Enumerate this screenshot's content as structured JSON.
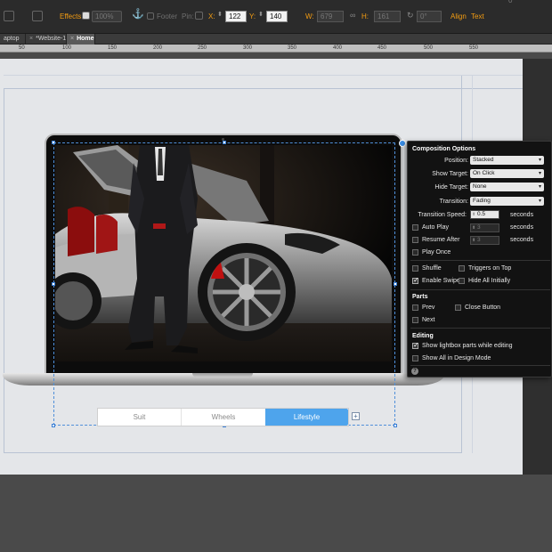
{
  "toolbar": {
    "effects_label": "Effects:",
    "opacity_value": "100%",
    "footer_label": "Footer",
    "pin_label": "Pin:",
    "x_label": "X:",
    "x_value": "122",
    "y_label": "Y:",
    "y_value": "140",
    "w_label": "W:",
    "w_value": "679",
    "h_label": "H:",
    "h_value": "161",
    "rotation_value": "0°",
    "align_label": "Align",
    "text_label": "Text",
    "fill_value": "0"
  },
  "tabs": [
    {
      "label": "aptop"
    },
    {
      "label": "*Website-1"
    },
    {
      "label": "Home"
    }
  ],
  "ruler": [
    "50",
    "100",
    "150",
    "200",
    "250",
    "300",
    "350",
    "400",
    "450",
    "500",
    "550"
  ],
  "widget": {
    "tabs": [
      {
        "label": "Suit"
      },
      {
        "label": "Wheels"
      },
      {
        "label": "Lifestyle"
      }
    ],
    "add_icon": "+"
  },
  "panel": {
    "title": "Composition Options",
    "position_label": "Position:",
    "position_value": "Stacked",
    "show_target_label": "Show Target:",
    "show_target_value": "On Click",
    "hide_target_label": "Hide Target:",
    "hide_target_value": "None",
    "transition_label": "Transition:",
    "transition_value": "Fading",
    "transition_speed_label": "Transition Speed:",
    "transition_speed_value": "0.5",
    "seconds": "seconds",
    "auto_play_label": "Auto Play",
    "auto_play_value": "3",
    "resume_after_label": "Resume After",
    "resume_after_value": "3",
    "play_once_label": "Play Once",
    "shuffle_label": "Shuffle",
    "triggers_on_top_label": "Triggers on Top",
    "enable_swipe_label": "Enable Swipe",
    "hide_all_initially_label": "Hide All Initially",
    "parts_title": "Parts",
    "prev_label": "Prev",
    "close_button_label": "Close Button",
    "next_label": "Next",
    "editing_title": "Editing",
    "show_lightbox_label": "Show lightbox parts while editing",
    "show_all_design_label": "Show All in Design Mode",
    "help_icon": "?",
    "checks": {
      "auto_play": false,
      "resume_after": false,
      "play_once": false,
      "shuffle": false,
      "triggers_on_top": false,
      "enable_swipe": true,
      "hide_all_initially": false,
      "prev": false,
      "close_button": false,
      "next": false,
      "show_lightbox": true,
      "show_all_design": false
    }
  },
  "colors": {
    "accent_orange": "#f39c12",
    "active_tab_blue": "#4ea4ec",
    "panel_bg": "#121212"
  }
}
